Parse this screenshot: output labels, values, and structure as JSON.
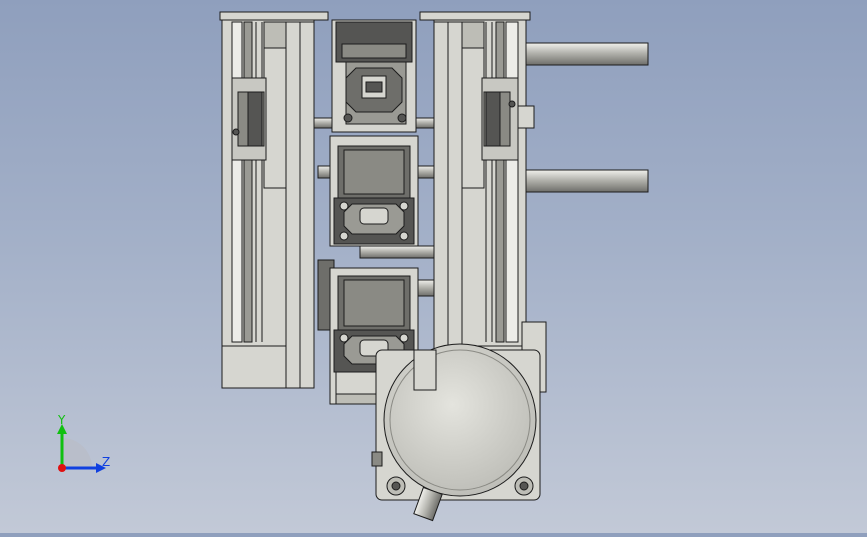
{
  "viewport": {
    "background_top": "#8f9fbd",
    "background_bottom": "#c2c9d7",
    "part_face_color": "#d6d6d0",
    "part_shadow_color": "#8a8a84",
    "part_dark_color": "#555553",
    "edge_color": "#1c1c1c"
  },
  "triad": {
    "y_label": "Y",
    "z_label": "Z",
    "y_color": "#10c010",
    "z_color": "#1040e0",
    "x_color": "#e01010"
  }
}
